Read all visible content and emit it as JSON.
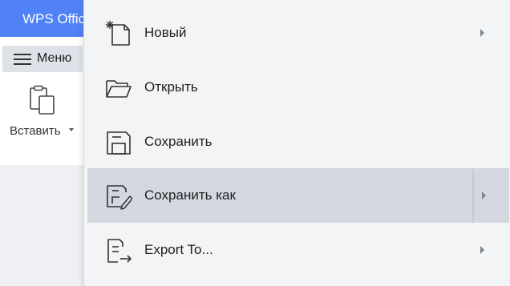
{
  "app": {
    "title": "WPS Office"
  },
  "toolbar": {
    "menu_label": "Меню",
    "paste_label": "Вставить"
  },
  "menu": {
    "items": [
      {
        "label": "Новый",
        "icon": "new-file-icon",
        "submenu": true
      },
      {
        "label": "Открыть",
        "icon": "open-folder-icon",
        "submenu": false
      },
      {
        "label": "Сохранить",
        "icon": "save-icon",
        "submenu": false
      },
      {
        "label": "Сохранить как",
        "icon": "save-as-icon",
        "submenu": true,
        "highlighted": true
      },
      {
        "label": "Export To...",
        "icon": "export-icon",
        "submenu": true
      }
    ]
  },
  "colors": {
    "titlebar": "#5082f5",
    "menu_background": "#f3f4f6",
    "menu_highlight": "#d3d8e0"
  }
}
